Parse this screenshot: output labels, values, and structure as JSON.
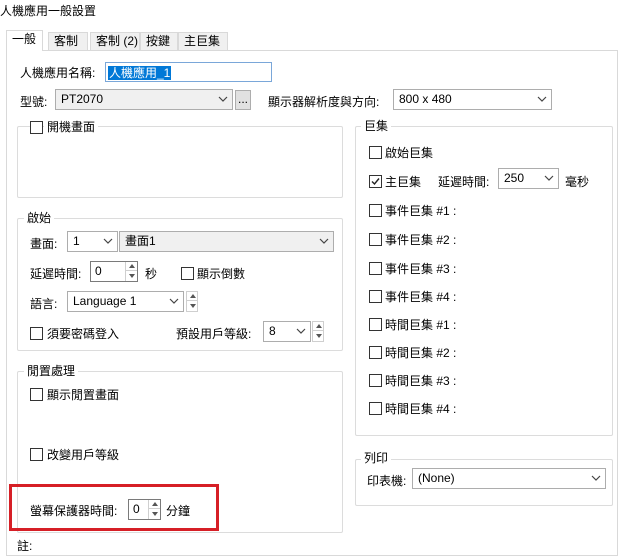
{
  "window": {
    "title": "人機應用一般設置"
  },
  "tabs": [
    {
      "label": "一般"
    },
    {
      "label": "客制"
    },
    {
      "label": "客制 (2)"
    },
    {
      "label": "按鍵"
    },
    {
      "label": "主巨集"
    }
  ],
  "general": {
    "name_label": "人機應用名稱:",
    "name_value": "人機應用_1",
    "model_label": "型號:",
    "model_value": "PT2070",
    "browse_label": "...",
    "resolution_label": "顯示器解析度與方向:",
    "resolution_value": "800 x 480"
  },
  "startup_screen": {
    "label": "開機畫面",
    "checked": false
  },
  "start": {
    "group_label": "啟始",
    "screen_label": "畫面:",
    "screen_number": "1",
    "screen_name": "畫面1",
    "delay_label": "延遲時間:",
    "delay_value": "0",
    "delay_unit": "秒",
    "countdown_label": "顯示倒數",
    "language_label": "語言:",
    "language_value": "Language 1",
    "password_label": "須要密碼登入",
    "user_level_label": "預設用戶等級:",
    "user_level_value": "8"
  },
  "idle": {
    "group_label": "閒置處理",
    "show_idle_label": "顯示閒置畫面",
    "change_level_label": "改變用戶等級",
    "screensaver_label": "螢幕保護器時間:",
    "screensaver_value": "0",
    "screensaver_unit": "分鐘"
  },
  "macro": {
    "group_label": "巨集",
    "items": [
      {
        "label": "啟始巨集",
        "checked": false
      },
      {
        "label": "主巨集",
        "checked": true
      },
      {
        "label": "事件巨集 #1 :",
        "checked": false
      },
      {
        "label": "事件巨集 #2 :",
        "checked": false
      },
      {
        "label": "事件巨集 #3 :",
        "checked": false
      },
      {
        "label": "事件巨集 #4 :",
        "checked": false
      },
      {
        "label": "時間巨集 #1 :",
        "checked": false
      },
      {
        "label": "時間巨集 #2 :",
        "checked": false
      },
      {
        "label": "時間巨集 #3 :",
        "checked": false
      },
      {
        "label": "時間巨集 #4 :",
        "checked": false
      }
    ],
    "delay_label": "延遲時間:",
    "delay_value": "250",
    "delay_unit": "毫秒"
  },
  "print": {
    "group_label": "列印",
    "printer_label": "印表機:",
    "printer_value": "(None)"
  },
  "note_label": "註:",
  "colors": {
    "highlight": "#d61f26",
    "selection": "#0078d7"
  }
}
